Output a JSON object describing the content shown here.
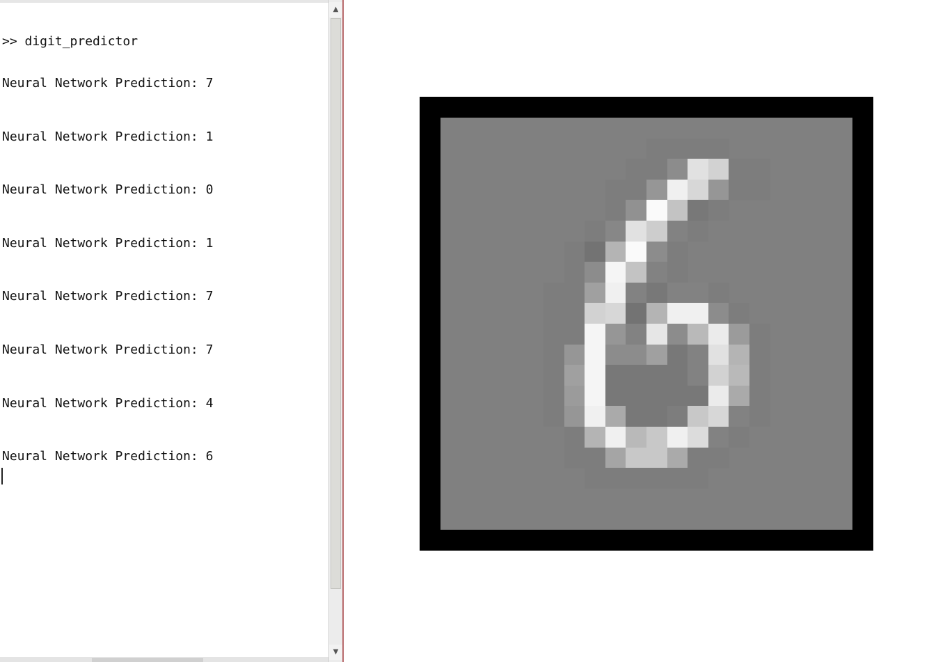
{
  "console": {
    "command": ">> digit_predictor",
    "prediction_label": "Neural Network Prediction:",
    "predictions": [
      "7",
      "1",
      "0",
      "1",
      "7",
      "7",
      "4",
      "6"
    ]
  },
  "figure": {
    "displayed_digit": "6",
    "image_rows": 20,
    "image_cols": 20,
    "background_gray": 128,
    "pixels": [
      [
        128,
        128,
        128,
        128,
        128,
        128,
        128,
        128,
        128,
        128,
        128,
        128,
        128,
        128,
        128,
        128,
        128,
        128,
        128,
        128
      ],
      [
        128,
        128,
        128,
        128,
        128,
        128,
        128,
        128,
        128,
        128,
        125,
        125,
        125,
        125,
        128,
        128,
        128,
        128,
        128,
        128
      ],
      [
        128,
        128,
        128,
        128,
        128,
        128,
        128,
        128,
        128,
        125,
        125,
        140,
        225,
        210,
        125,
        125,
        128,
        128,
        128,
        128
      ],
      [
        128,
        128,
        128,
        128,
        128,
        128,
        128,
        128,
        125,
        125,
        150,
        240,
        215,
        150,
        125,
        125,
        128,
        128,
        128,
        128
      ],
      [
        128,
        128,
        128,
        128,
        128,
        128,
        128,
        128,
        125,
        145,
        250,
        195,
        120,
        125,
        128,
        128,
        128,
        128,
        128,
        128
      ],
      [
        128,
        128,
        128,
        128,
        128,
        128,
        128,
        125,
        135,
        225,
        205,
        130,
        125,
        128,
        128,
        128,
        128,
        128,
        128,
        128
      ],
      [
        128,
        128,
        128,
        128,
        128,
        128,
        125,
        115,
        180,
        250,
        140,
        125,
        128,
        128,
        128,
        128,
        128,
        128,
        128,
        128
      ],
      [
        128,
        128,
        128,
        128,
        128,
        128,
        125,
        140,
        245,
        195,
        130,
        125,
        128,
        128,
        128,
        128,
        128,
        128,
        128,
        128
      ],
      [
        128,
        128,
        128,
        128,
        128,
        125,
        125,
        160,
        240,
        130,
        120,
        130,
        130,
        125,
        128,
        128,
        128,
        128,
        128,
        128
      ],
      [
        128,
        128,
        128,
        128,
        128,
        125,
        125,
        210,
        215,
        115,
        180,
        240,
        240,
        140,
        125,
        128,
        128,
        128,
        128,
        128
      ],
      [
        128,
        128,
        128,
        128,
        128,
        125,
        125,
        245,
        150,
        130,
        230,
        140,
        185,
        235,
        155,
        125,
        128,
        128,
        128,
        128
      ],
      [
        128,
        128,
        128,
        128,
        128,
        125,
        150,
        245,
        140,
        140,
        160,
        120,
        130,
        225,
        180,
        125,
        128,
        128,
        128,
        128
      ],
      [
        128,
        128,
        128,
        128,
        128,
        125,
        160,
        245,
        120,
        120,
        120,
        120,
        130,
        210,
        185,
        125,
        128,
        128,
        128,
        128
      ],
      [
        128,
        128,
        128,
        128,
        128,
        125,
        155,
        245,
        120,
        120,
        120,
        120,
        120,
        235,
        170,
        125,
        128,
        128,
        128,
        128
      ],
      [
        128,
        128,
        128,
        128,
        128,
        125,
        150,
        240,
        170,
        120,
        120,
        125,
        200,
        215,
        130,
        125,
        128,
        128,
        128,
        128
      ],
      [
        128,
        128,
        128,
        128,
        128,
        128,
        125,
        180,
        240,
        185,
        200,
        240,
        220,
        130,
        125,
        128,
        128,
        128,
        128,
        128
      ],
      [
        128,
        128,
        128,
        128,
        128,
        128,
        125,
        125,
        165,
        200,
        200,
        170,
        125,
        125,
        128,
        128,
        128,
        128,
        128,
        128
      ],
      [
        128,
        128,
        128,
        128,
        128,
        128,
        128,
        125,
        125,
        125,
        125,
        125,
        125,
        128,
        128,
        128,
        128,
        128,
        128,
        128
      ],
      [
        128,
        128,
        128,
        128,
        128,
        128,
        128,
        128,
        128,
        128,
        128,
        128,
        128,
        128,
        128,
        128,
        128,
        128,
        128,
        128
      ],
      [
        128,
        128,
        128,
        128,
        128,
        128,
        128,
        128,
        128,
        128,
        128,
        128,
        128,
        128,
        128,
        128,
        128,
        128,
        128,
        128
      ]
    ]
  }
}
